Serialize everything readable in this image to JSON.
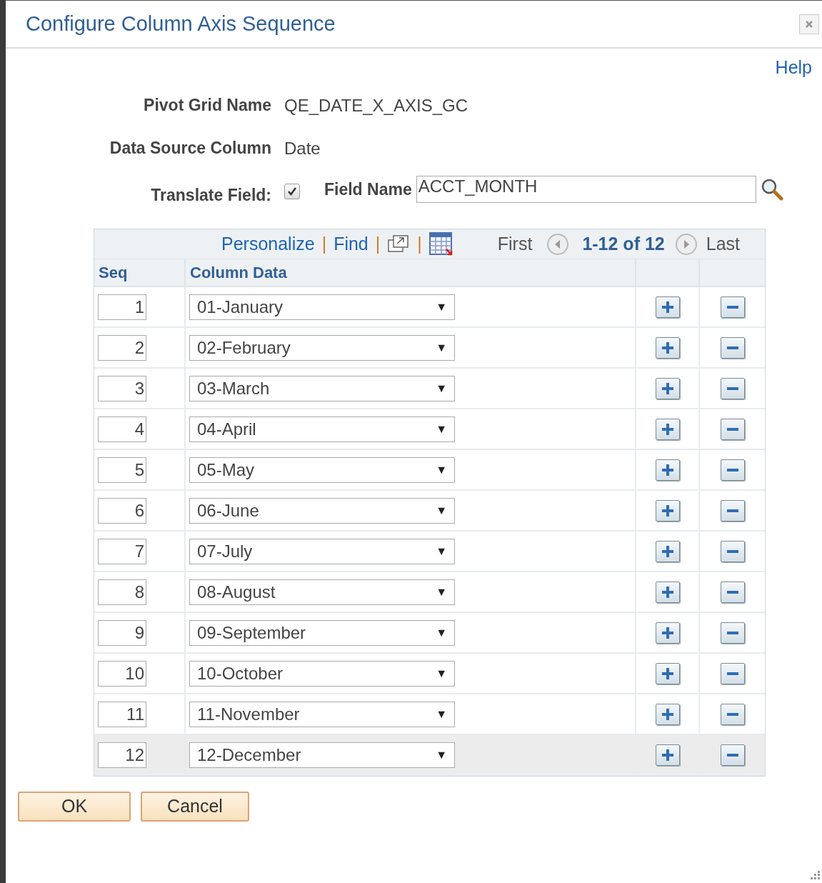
{
  "dialog": {
    "title": "Configure Column Axis Sequence",
    "help_link": "Help"
  },
  "form": {
    "pivot_grid_name_label": "Pivot Grid Name",
    "pivot_grid_name": "QE_DATE_X_AXIS_GC",
    "data_source_column_label": "Data Source Column",
    "data_source_column": "Date",
    "translate_field_label": "Translate Field:",
    "translate_field_checked": true,
    "field_name_label": "Field Name",
    "field_name": "ACCT_MONTH"
  },
  "grid": {
    "toolbar": {
      "personalize": "Personalize",
      "find": "Find",
      "separator": "|",
      "first": "First",
      "range": "1-12 of 12",
      "last": "Last"
    },
    "columns": [
      "Seq",
      "Column Data"
    ],
    "rows": [
      {
        "seq": "1",
        "value": "01-January",
        "selected": false
      },
      {
        "seq": "2",
        "value": "02-February",
        "selected": false
      },
      {
        "seq": "3",
        "value": "03-March",
        "selected": false
      },
      {
        "seq": "4",
        "value": "04-April",
        "selected": false
      },
      {
        "seq": "5",
        "value": "05-May",
        "selected": false
      },
      {
        "seq": "6",
        "value": "06-June",
        "selected": false
      },
      {
        "seq": "7",
        "value": "07-July",
        "selected": false
      },
      {
        "seq": "8",
        "value": "08-August",
        "selected": false
      },
      {
        "seq": "9",
        "value": "09-September",
        "selected": false
      },
      {
        "seq": "10",
        "value": "10-October",
        "selected": false
      },
      {
        "seq": "11",
        "value": "11-November",
        "selected": false
      },
      {
        "seq": "12",
        "value": "12-December",
        "selected": true
      }
    ],
    "dropdown_arrow": "▼"
  },
  "buttons": [
    "OK",
    "Cancel"
  ]
}
